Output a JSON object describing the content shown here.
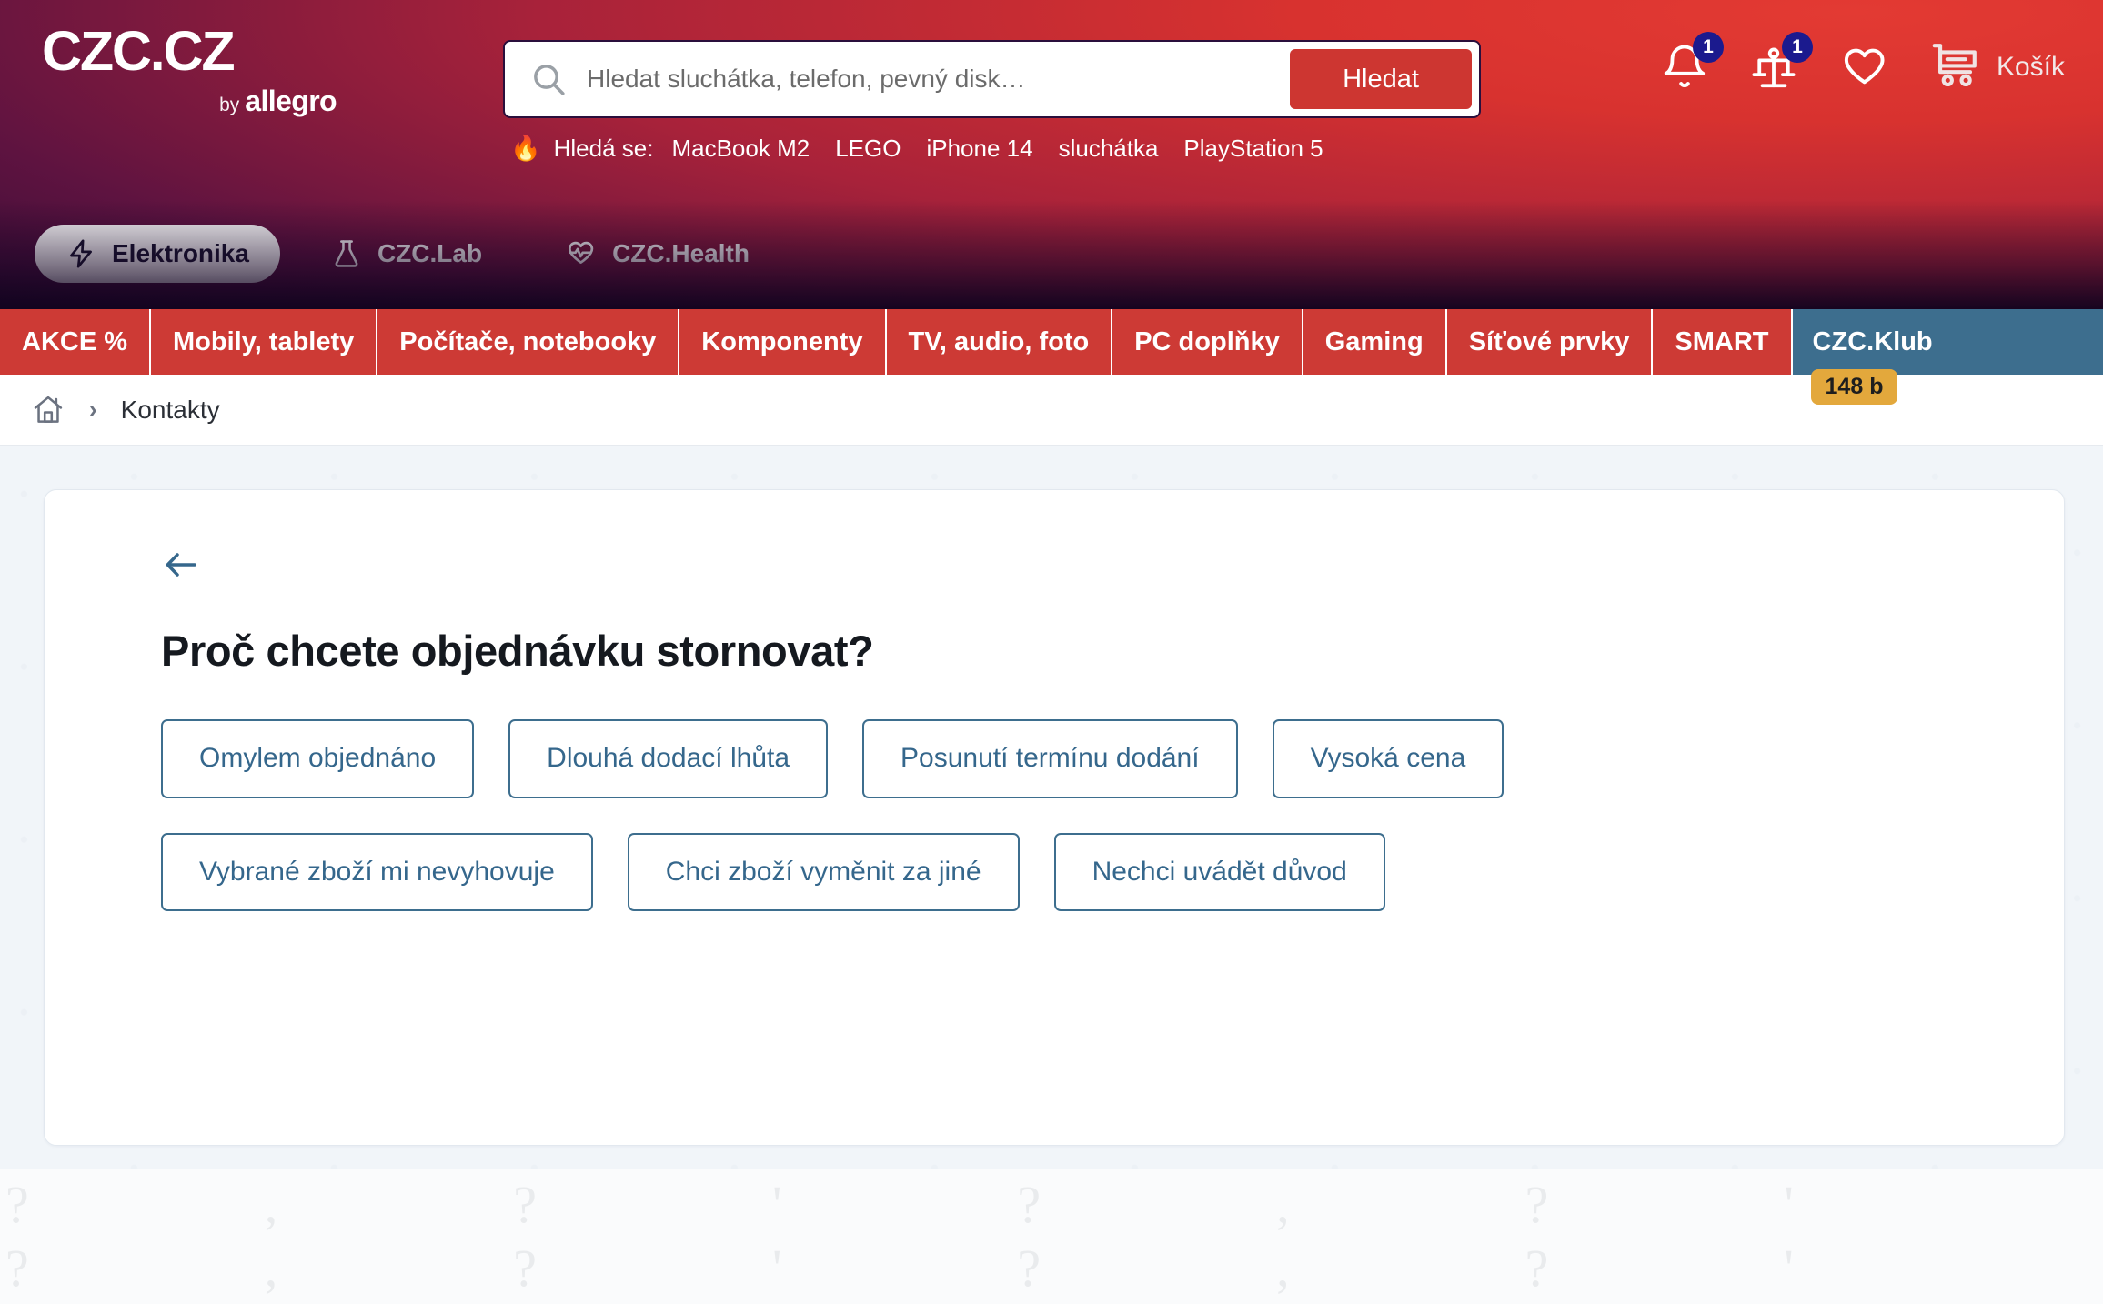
{
  "brand": {
    "logo_main": "CZC.CZ",
    "logo_by": "by",
    "logo_allegro": "allegro",
    "accent_red": "#cd3a35",
    "accent_blue": "#3d6e8e",
    "badge_navy": "#1b1a8e",
    "badge_orange": "#e3a83c"
  },
  "search": {
    "placeholder": "Hledat sluchátka, telefon, pevný disk…",
    "value": "",
    "button_label": "Hledat",
    "icon": "search-icon"
  },
  "trending": {
    "fire_icon": "🔥",
    "label": "Hledá se:",
    "items": [
      "MacBook M2",
      "LEGO",
      "iPhone 14",
      "sluchátka",
      "PlayStation 5"
    ]
  },
  "header_icons": [
    {
      "name": "notifications-bell-icon",
      "badge": "1"
    },
    {
      "name": "compare-scales-icon",
      "badge": "1"
    },
    {
      "name": "favorites-heart-icon",
      "badge": ""
    },
    {
      "name": "cart-icon",
      "badge": "",
      "label": "Košík"
    }
  ],
  "vertical_tabs": [
    {
      "label": "Elektronika",
      "icon": "lightning-bolt-icon",
      "active": true
    },
    {
      "label": "CZC.Lab",
      "icon": "flask-icon",
      "active": false
    },
    {
      "label": "CZC.Health",
      "icon": "heart-pulse-icon",
      "active": false
    }
  ],
  "nav_items": [
    {
      "label": "AKCE %"
    },
    {
      "label": "Mobily, tablety"
    },
    {
      "label": "Počítače, notebooky"
    },
    {
      "label": "Komponenty"
    },
    {
      "label": "TV, audio, foto"
    },
    {
      "label": "PC doplňky"
    },
    {
      "label": "Gaming"
    },
    {
      "label": "Síťové prvky"
    },
    {
      "label": "SMART"
    }
  ],
  "klub": {
    "label": "CZC.Klub",
    "points_badge": "148 b"
  },
  "breadcrumb": {
    "home_icon": "home-icon",
    "separator": "›",
    "current": "Kontakty"
  },
  "card": {
    "back_icon": "arrow-left-icon",
    "title": "Proč chcete objednávku stornovat?",
    "options": [
      "Omylem objednáno",
      "Dlouhá dodací lhůta",
      "Posunutí termínu dodání",
      "Vysoká cena",
      "Vybrané zboží mi nevyhovuje",
      "Chci zboží vyměnit za jiné",
      "Nechci uvádět důvod"
    ]
  },
  "footer": {
    "pattern_glyphs": "?  ,  ?  '  ?  ,  ?  '  ?  ,  ?  '  ?  ,  ?  '  ?  ,  ?\n'  ?  ,  ?  '  ?  ,  ?  '  ?  ,  ?  '  ?  ,  ?  '  ?  ,"
  }
}
